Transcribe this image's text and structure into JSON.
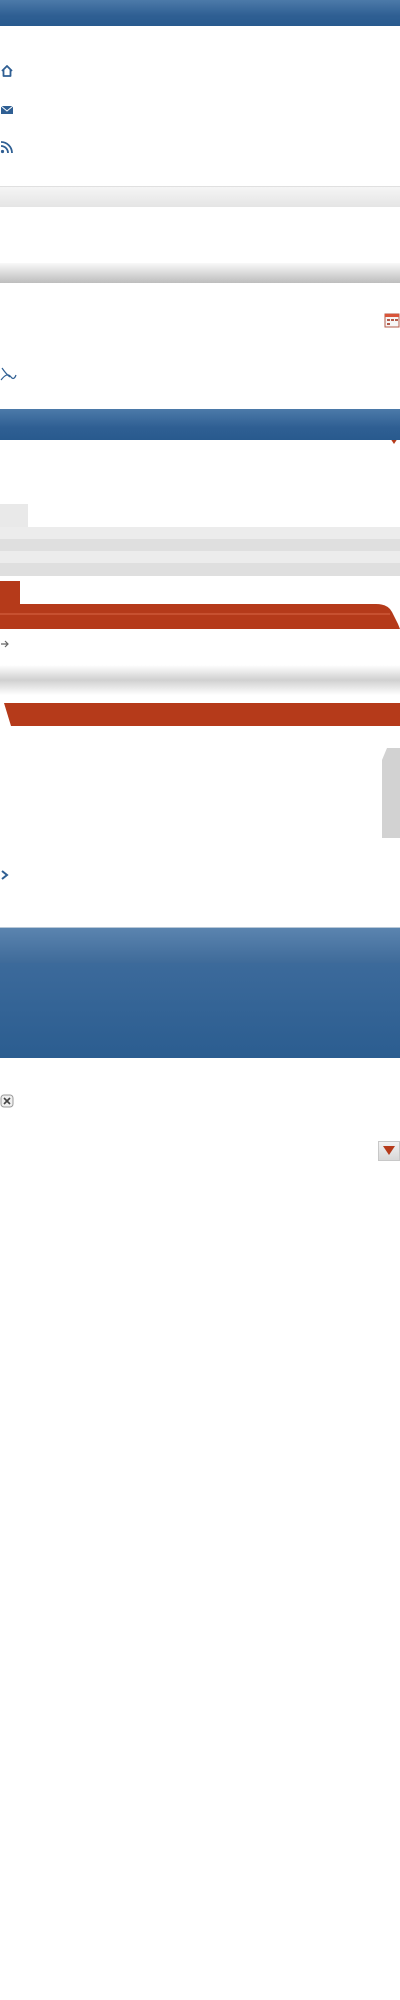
{
  "colors": {
    "brand_blue": "#2f5f93",
    "accent_red": "#b53a1a",
    "light_gray": "#e6e6e6",
    "mid_gray": "#cfcfcf"
  },
  "icons": {
    "home": "home-icon",
    "mail": "mail-icon",
    "rss": "rss-icon",
    "dropdown": "chevron-down-icon",
    "calendar": "calendar-icon",
    "signature": "signature-icon",
    "arrow": "arrow-icon",
    "close": "close-icon"
  },
  "dropdown": {
    "value": ""
  },
  "search": {
    "value": ""
  }
}
